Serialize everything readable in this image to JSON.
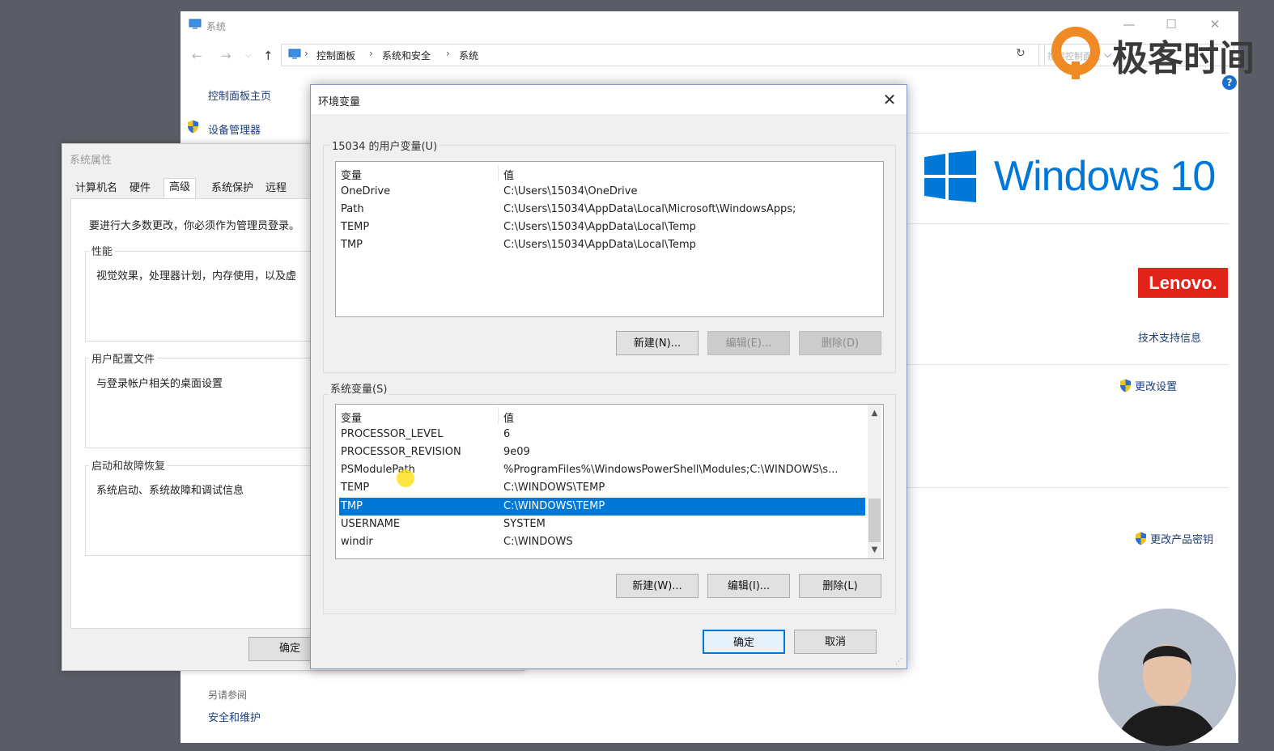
{
  "system_window": {
    "title": "系统",
    "breadcrumb": [
      "控制面板",
      "系统和安全",
      "系统"
    ],
    "search_placeholder": "搜索控制面板",
    "sidebar": {
      "home": "控制面板主页",
      "device_manager": "设备管理器",
      "see_also": "另请参阅",
      "security_maintenance": "安全和维护"
    },
    "windows_brand": "Windows 10",
    "oem_logo": "Lenovo.",
    "tech_support": "技术支持信息",
    "change_settings": "更改设置",
    "change_product_key": "更改产品密钥"
  },
  "watermark": {
    "text": "极客时间"
  },
  "system_properties": {
    "title": "系统属性",
    "tabs": [
      "计算机名",
      "硬件",
      "高级",
      "系统保护",
      "远程"
    ],
    "active_tab": "高级",
    "admin_note": "要进行大多数更改，你必须作为管理员登录。",
    "performance": {
      "label": "性能",
      "text": "视觉效果，处理器计划，内存使用，以及虚"
    },
    "user_profiles": {
      "label": "用户配置文件",
      "text": "与登录帐户相关的桌面设置"
    },
    "startup_recovery": {
      "label": "启动和故障恢复",
      "text": "系统启动、系统故障和调试信息"
    },
    "ok_label": "确定"
  },
  "env_dialog": {
    "title": "环境变量",
    "close_glyph": "✕",
    "user_vars": {
      "label": "15034 的用户变量(U)",
      "col_name": "变量",
      "col_value": "值",
      "rows": [
        {
          "name": "OneDrive",
          "value": "C:\\Users\\15034\\OneDrive"
        },
        {
          "name": "Path",
          "value": "C:\\Users\\15034\\AppData\\Local\\Microsoft\\WindowsApps;"
        },
        {
          "name": "TEMP",
          "value": "C:\\Users\\15034\\AppData\\Local\\Temp"
        },
        {
          "name": "TMP",
          "value": "C:\\Users\\15034\\AppData\\Local\\Temp"
        }
      ],
      "buttons": {
        "new": "新建(N)...",
        "edit": "编辑(E)...",
        "delete": "删除(D)"
      }
    },
    "system_vars": {
      "label": "系统变量(S)",
      "col_name": "变量",
      "col_value": "值",
      "rows": [
        {
          "name": "PROCESSOR_LEVEL",
          "value": "6"
        },
        {
          "name": "PROCESSOR_REVISION",
          "value": "9e09"
        },
        {
          "name": "PSModulePath",
          "value": "%ProgramFiles%\\WindowsPowerShell\\Modules;C:\\WINDOWS\\s..."
        },
        {
          "name": "TEMP",
          "value": "C:\\WINDOWS\\TEMP"
        },
        {
          "name": "TMP",
          "value": "C:\\WINDOWS\\TEMP"
        },
        {
          "name": "USERNAME",
          "value": "SYSTEM"
        },
        {
          "name": "windir",
          "value": "C:\\WINDOWS"
        }
      ],
      "selected_row": "TMP",
      "buttons": {
        "new": "新建(W)...",
        "edit": "编辑(I)...",
        "delete": "删除(L)"
      }
    },
    "ok_label": "确定",
    "cancel_label": "取消"
  },
  "colors": {
    "selection": "#0078d7",
    "windows_blue": "#0078d7",
    "lenovo_red": "#e2231a",
    "link": "#1d3f7a"
  }
}
